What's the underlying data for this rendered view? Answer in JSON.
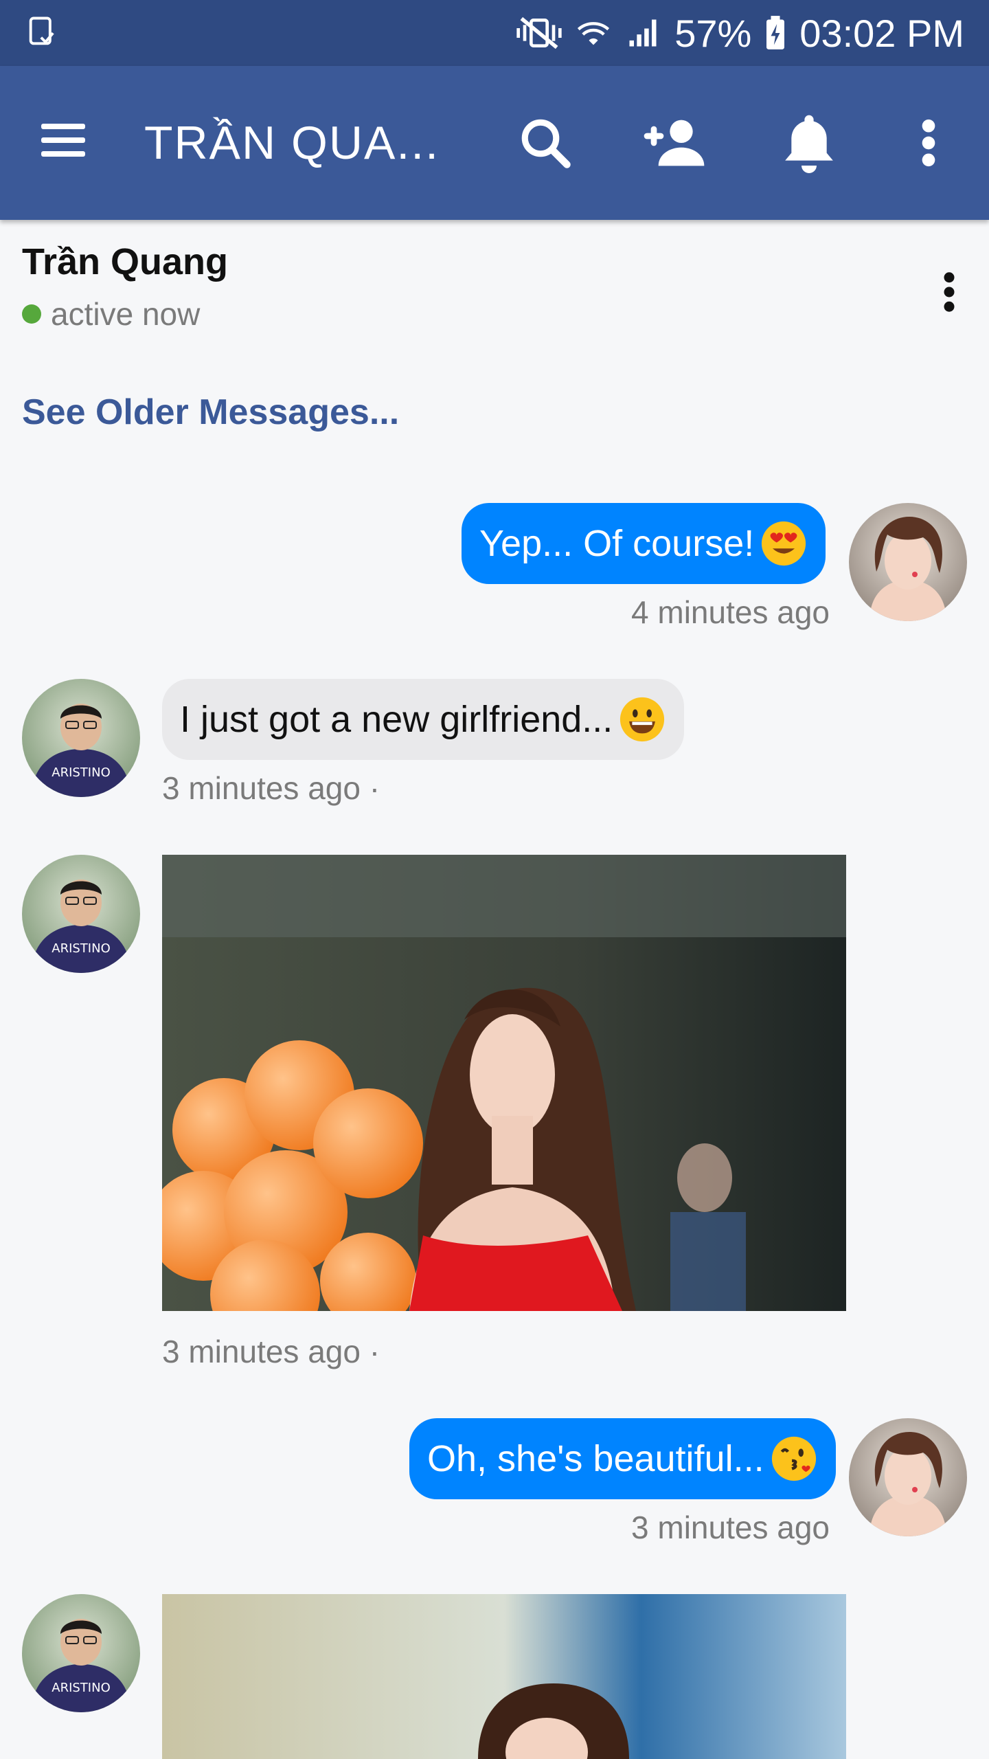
{
  "status_bar": {
    "battery": "57%",
    "time": "03:02 PM"
  },
  "app_bar": {
    "title": "TRẦN QUA..."
  },
  "conversation": {
    "contact_name": "Trần Quang",
    "presence": "active now",
    "see_older": "See Older Messages..."
  },
  "messages": [
    {
      "text": "Yep... Of course!",
      "time": "4 minutes ago"
    },
    {
      "text": "I just got a new girlfriend...",
      "time": "3 minutes ago ·"
    },
    {
      "time": "3 minutes ago ·"
    },
    {
      "text": "Oh, she's beautiful...",
      "time": "3 minutes ago"
    }
  ],
  "colors": {
    "status_bar": "#2f4a82",
    "app_bar": "#3b5998",
    "outgoing_bubble": "#0084ff",
    "incoming_bubble": "#e9e9eb",
    "presence_dot": "#56a83c"
  },
  "icons": [
    "menu-icon",
    "search-icon",
    "add-friend-icon",
    "bell-icon",
    "more-vert-icon"
  ]
}
